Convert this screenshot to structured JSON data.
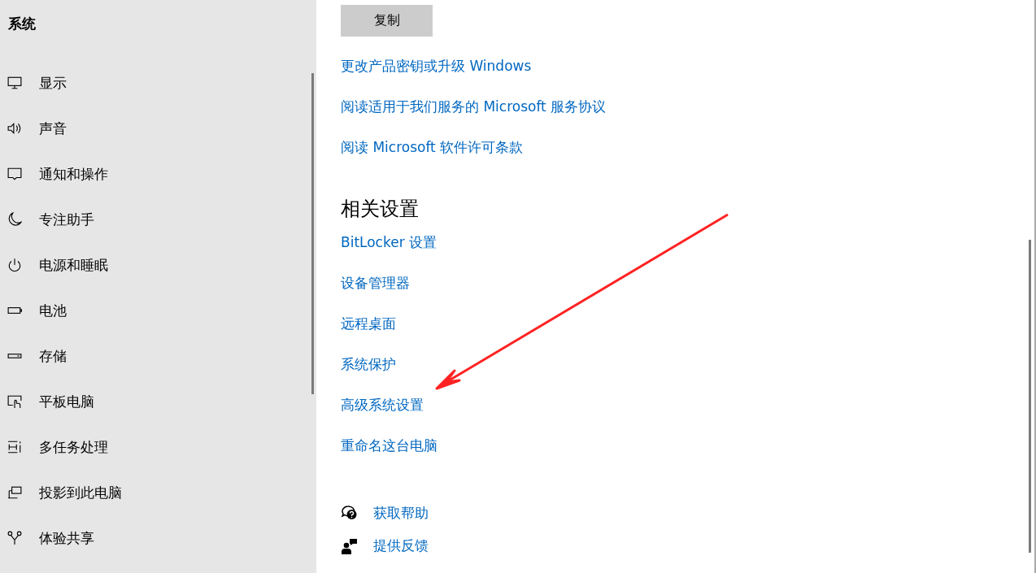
{
  "sidebar": {
    "title": "系统",
    "items": [
      {
        "label": "显示",
        "kind": "display",
        "selected": false
      },
      {
        "label": "声音",
        "kind": "sound",
        "selected": false
      },
      {
        "label": "通知和操作",
        "kind": "notify",
        "selected": false
      },
      {
        "label": "专注助手",
        "kind": "moon",
        "selected": false
      },
      {
        "label": "电源和睡眠",
        "kind": "power",
        "selected": false
      },
      {
        "label": "电池",
        "kind": "battery",
        "selected": false
      },
      {
        "label": "存储",
        "kind": "storage",
        "selected": false
      },
      {
        "label": "平板电脑",
        "kind": "tablet",
        "selected": false
      },
      {
        "label": "多任务处理",
        "kind": "multitask",
        "selected": false
      },
      {
        "label": "投影到此电脑",
        "kind": "project",
        "selected": false
      },
      {
        "label": "体验共享",
        "kind": "share",
        "selected": false
      }
    ]
  },
  "main": {
    "copy_button": "复制",
    "links": [
      "更改产品密钥或升级 Windows",
      "阅读适用于我们服务的 Microsoft 服务协议",
      "阅读 Microsoft 软件许可条款"
    ],
    "related": {
      "heading": "相关设置",
      "links": [
        "BitLocker 设置",
        "设备管理器",
        "远程桌面",
        "系统保护",
        "高级系统设置",
        "重命名这台电脑"
      ]
    },
    "help": [
      {
        "label": "获取帮助",
        "kind": "help"
      },
      {
        "label": "提供反馈",
        "kind": "feedback"
      }
    ]
  }
}
